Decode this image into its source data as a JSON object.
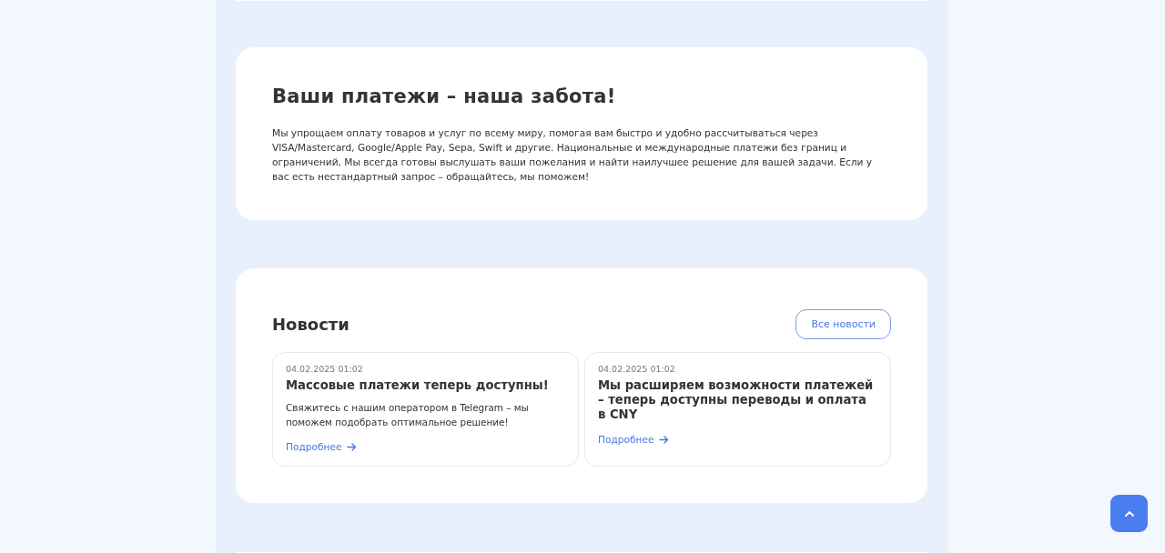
{
  "about": {
    "title": "Ваши платежи – наша забота!",
    "text": "Мы упрощаем оплату товаров и услуг по всему миру, помогая вам быстро и удобно рассчитываться через VISA/Mastercard, Google/Apple Pay, Sepa, Swift и другие. Национальные и международные платежи без границ и ограничений, Мы всегда готовы выслушать ваши пожелания и найти наилучшее решение для вашей задачи. Если у вас есть нестандартный запрос – обращайтесь, мы поможем!"
  },
  "news": {
    "title": "Новости",
    "all_button": "Все новости",
    "items": [
      {
        "date": "04.02.2025 01:02",
        "title": "Массовые платежи теперь доступны!",
        "text": "Свяжитесь с нашим оператором в Telegram – мы поможем подобрать оптимальное решение!",
        "link": "Подробнее"
      },
      {
        "date": "04.02.2025 01:02",
        "title": "Мы расширяем возможности платежей – теперь доступны переводы и оплата в CNY",
        "link": "Подробнее"
      }
    ]
  }
}
